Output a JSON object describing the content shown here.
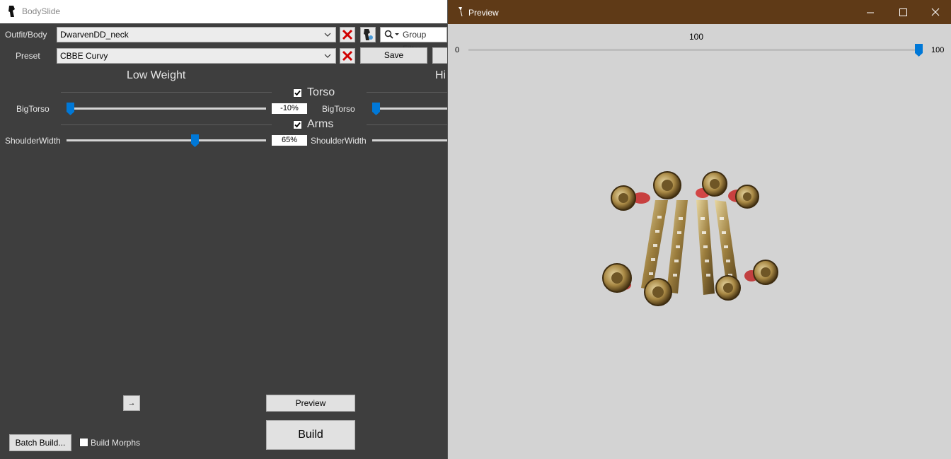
{
  "main_window": {
    "title": "BodySlide",
    "outfit_label": "Outfit/Body",
    "outfit_value": "DwarvenDD_neck",
    "group_filter_placeholder": "Group Filter",
    "preset_label": "Preset",
    "preset_value": "CBBE Curvy",
    "save_label": "Save",
    "low_weight_label": "Low Weight",
    "high_weight_label": "Hi",
    "categories": [
      {
        "name": "Torso",
        "checked": true
      },
      {
        "name": "Arms",
        "checked": true
      }
    ],
    "sliders": [
      {
        "name": "BigTorso",
        "low_value": "-10%",
        "low_fraction": -0.1,
        "high_name": "BigTorso"
      },
      {
        "name": "ShoulderWidth",
        "low_value": "65%",
        "low_fraction": 0.65,
        "high_name": "ShoulderWidth"
      }
    ],
    "arrow_button": "→",
    "preview_button": "Preview",
    "build_button": "Build",
    "batch_build_button": "Batch Build...",
    "build_morphs_label": "Build Morphs"
  },
  "preview_window": {
    "title": "Preview",
    "weight_value": "100",
    "weight_min": "0",
    "weight_max": "100",
    "weight_fraction": 1.0,
    "subject": "dwarven-necklace-model"
  },
  "colors": {
    "accent": "#0078d7",
    "panel_bg": "#3e3e3e",
    "preview_bg": "#d3d3d3",
    "preview_titlebar": "#5f3a17",
    "close_x": "#d00000"
  }
}
